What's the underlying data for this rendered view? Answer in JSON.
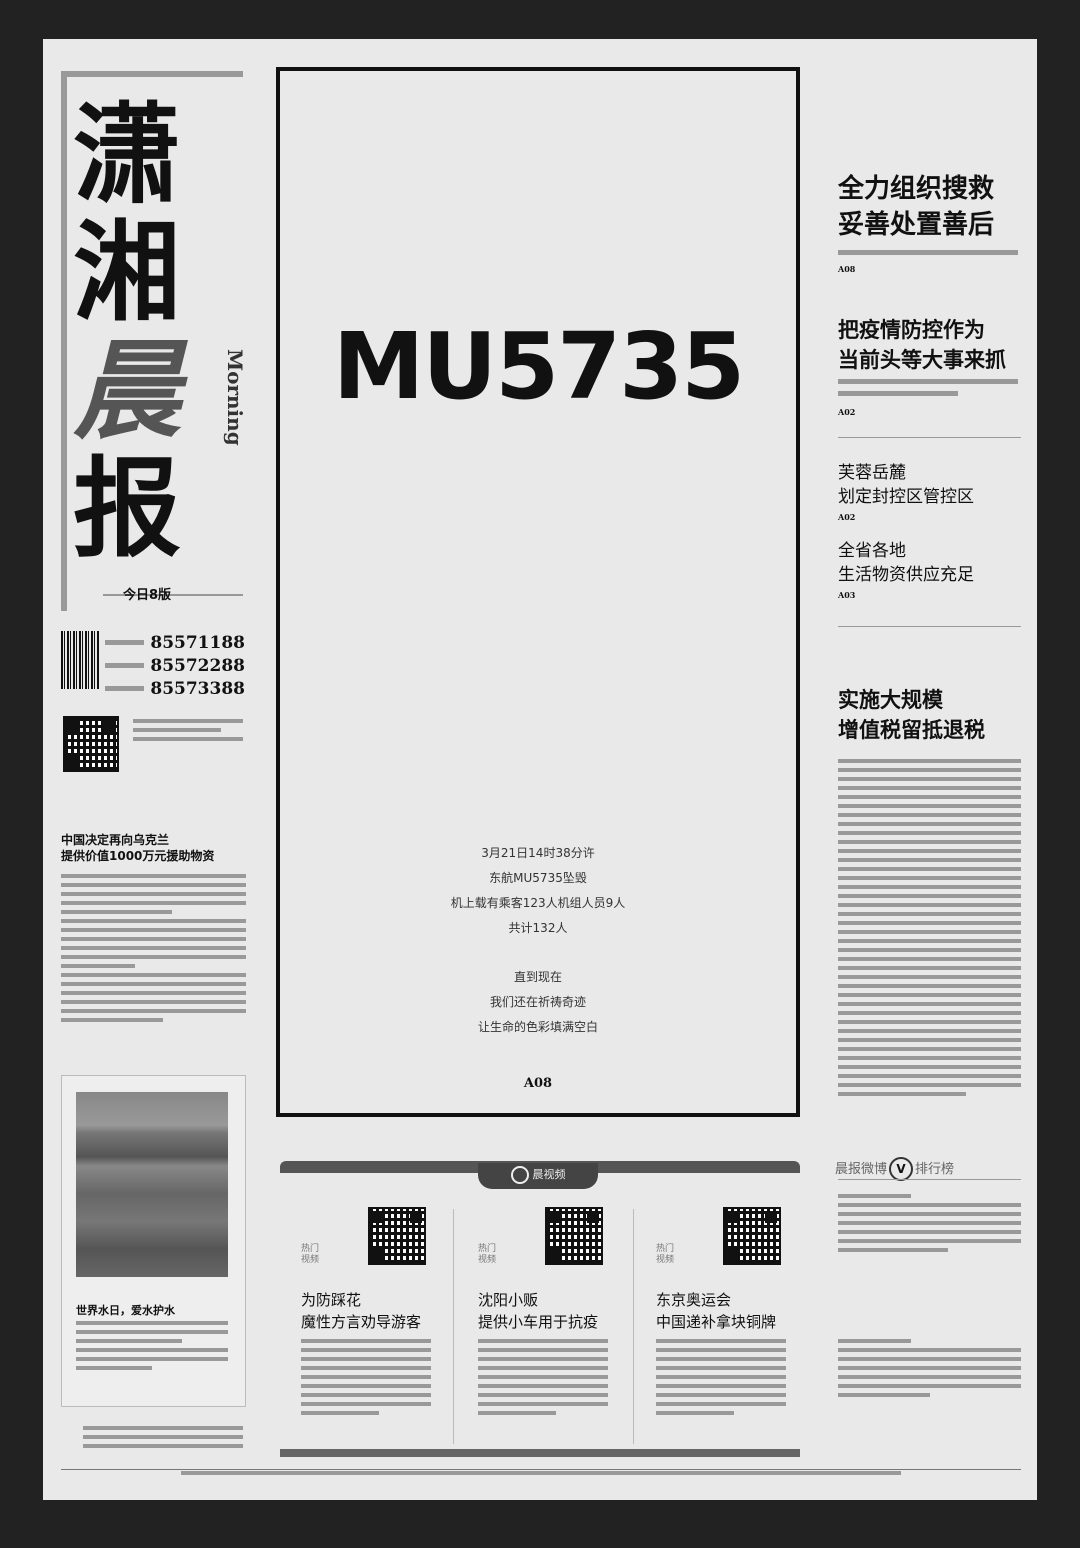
{
  "masthead": {
    "title_chars": [
      "潇",
      "湘",
      "晨",
      "报"
    ],
    "english": "Morning",
    "edition": "今日8版",
    "phones": [
      "85571188",
      "85572288",
      "85573388"
    ]
  },
  "left_column": {
    "story1_title": [
      "中国决定再向乌克兰",
      "提供价值1000万元援助物资"
    ],
    "photo_caption": "世界水日，爱水护水"
  },
  "front": {
    "headline": "MU5735",
    "lines": [
      "3月21日14时38分许",
      "东航MU5735坠毁",
      "机上载有乘客123人机组人员9人",
      "共计132人"
    ],
    "lines2": [
      "直到现在",
      "我们还在祈祷奇迹",
      "让生命的色彩填满空白"
    ],
    "page_ref": "A08"
  },
  "right_column": {
    "story1": {
      "title": [
        "全力组织搜救",
        "妥善处置善后"
      ],
      "page": "A08"
    },
    "story2": {
      "title": [
        "把疫情防控作为",
        "当前头等大事来抓"
      ],
      "page": "A02"
    },
    "story3": {
      "title": [
        "芙蓉岳麓",
        "划定封控区管控区"
      ],
      "page": "A02"
    },
    "story4": {
      "title": [
        "全省各地",
        "生活物资供应充足"
      ],
      "page": "A03"
    },
    "story5": {
      "title": [
        "实施大规模",
        "增值税留抵退税"
      ]
    },
    "weibo_title": {
      "pre": "晨报微博",
      "mark": "V",
      "post": "排行榜"
    }
  },
  "bottom_panel": {
    "tab_label": "晨视频",
    "columns": [
      {
        "hot": "热门视频",
        "title": [
          "为防踩花",
          "魔性方言劝导游客"
        ]
      },
      {
        "hot": "热门视频",
        "title": [
          "沈阳小贩",
          "提供小车用于抗疫"
        ]
      },
      {
        "hot": "热门视频",
        "title": [
          "东京奥运会",
          "中国递补拿块铜牌"
        ]
      }
    ]
  }
}
